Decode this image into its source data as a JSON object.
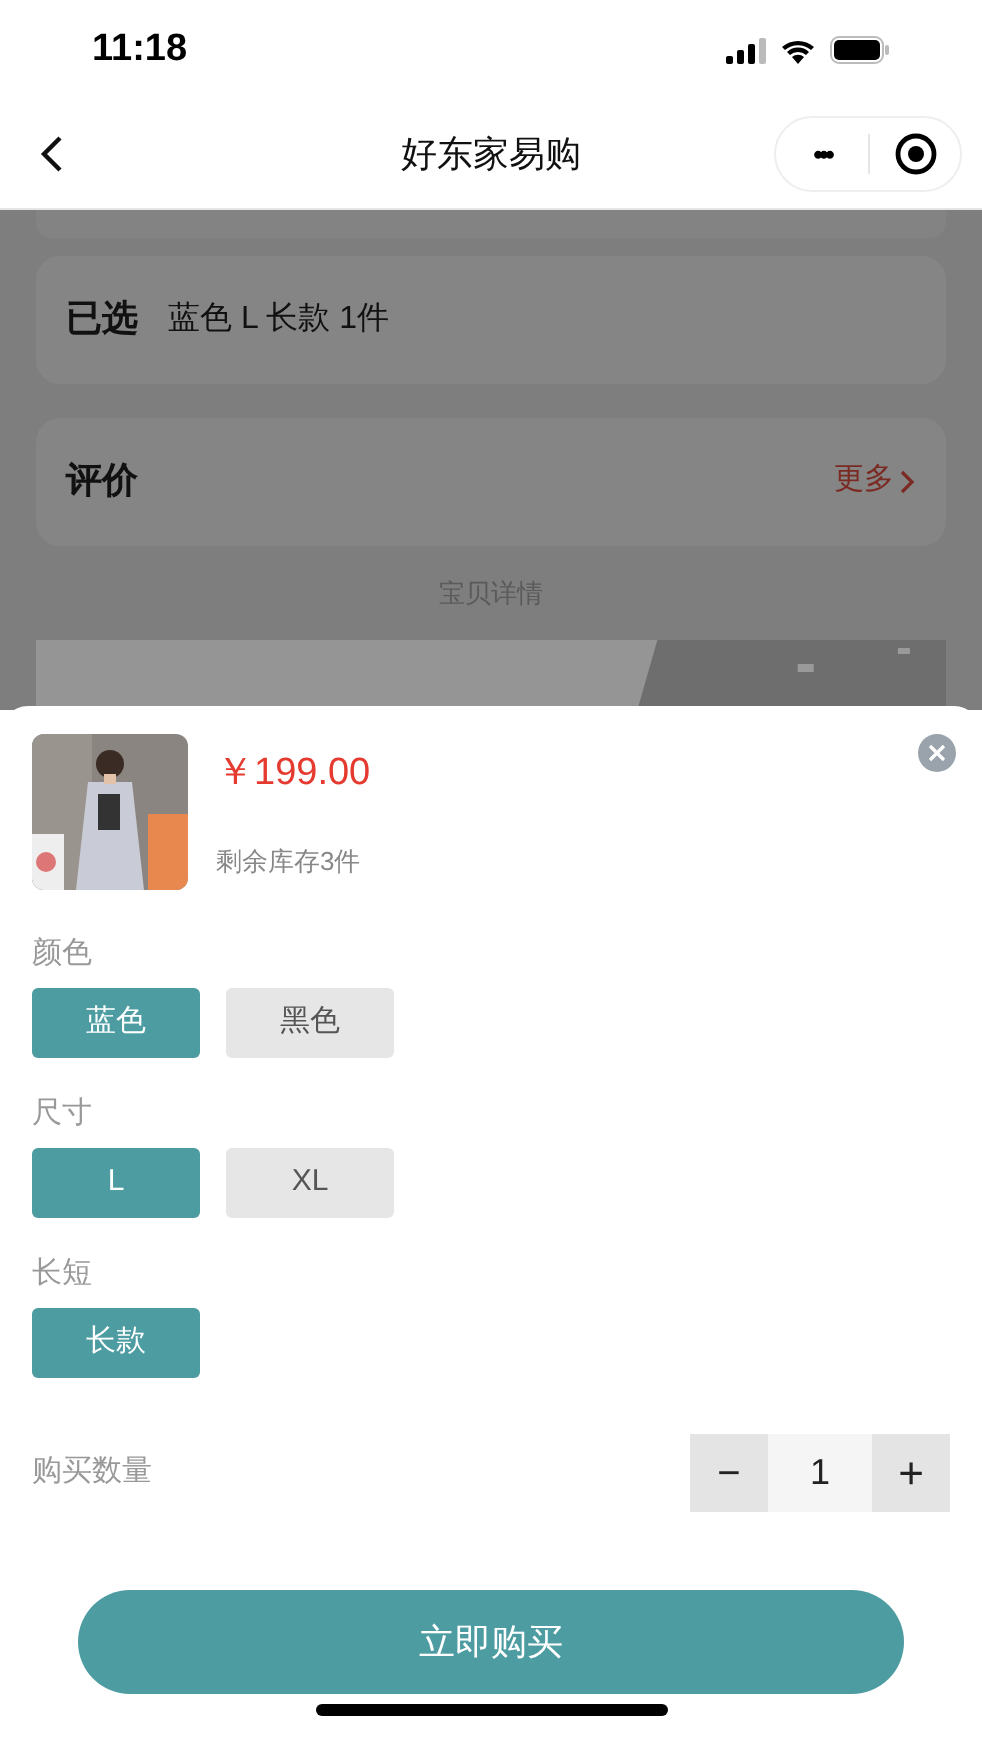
{
  "status_bar": {
    "time": "11:18"
  },
  "nav": {
    "title": "好东家易购",
    "more": "•••"
  },
  "background": {
    "selected_label": "已选",
    "selected_value": "蓝色 L 长款 1件",
    "reviews_label": "评价",
    "reviews_more": "更多",
    "details_label": "宝贝详情"
  },
  "sheet": {
    "price": "￥199.00",
    "stock": "剩余库存3件",
    "options": [
      {
        "label": "颜色",
        "values": [
          {
            "label": "蓝色",
            "selected": true
          },
          {
            "label": "黑色",
            "selected": false
          }
        ]
      },
      {
        "label": "尺寸",
        "values": [
          {
            "label": "L",
            "selected": true
          },
          {
            "label": "XL",
            "selected": false
          }
        ]
      },
      {
        "label": "长短",
        "values": [
          {
            "label": "长款",
            "selected": true
          }
        ]
      }
    ],
    "quantity": {
      "label": "购买数量",
      "minus": "−",
      "value": "1",
      "plus": "+"
    },
    "buy_button": "立即购买"
  }
}
